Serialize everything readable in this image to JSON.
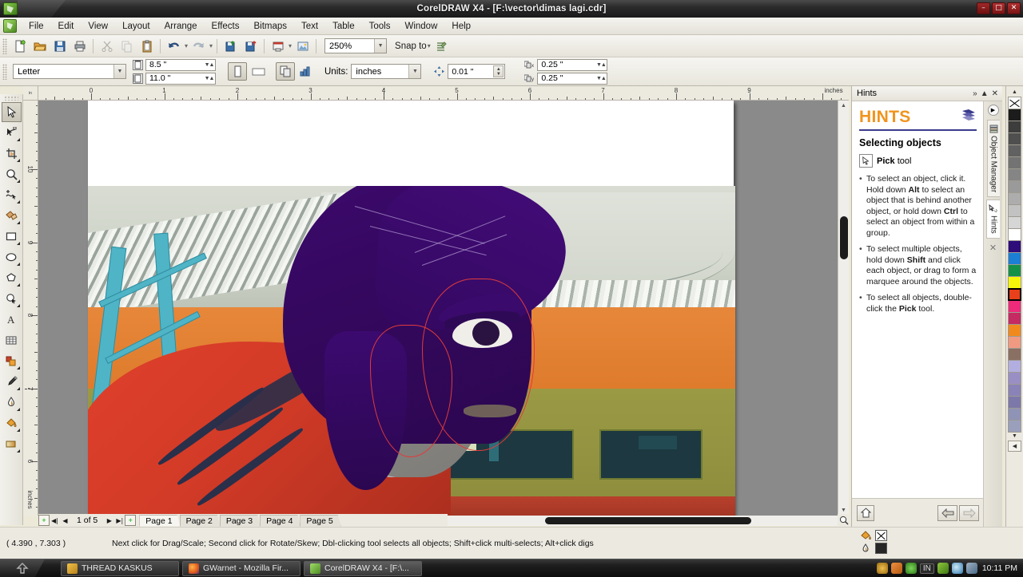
{
  "window": {
    "title": "CorelDRAW X4 - [F:\\vector\\dimas lagi.cdr]",
    "minimize_label": "–",
    "maximize_label": "□",
    "close_label": "✕"
  },
  "menubar": {
    "items": [
      {
        "label": "File",
        "icon": "file-menu"
      },
      {
        "label": "Edit",
        "icon": "edit-menu"
      },
      {
        "label": "View",
        "icon": "view-menu"
      },
      {
        "label": "Layout",
        "icon": "layout-menu"
      },
      {
        "label": "Arrange",
        "icon": "arrange-menu"
      },
      {
        "label": "Effects",
        "icon": "effects-menu"
      },
      {
        "label": "Bitmaps",
        "icon": "bitmaps-menu"
      },
      {
        "label": "Text",
        "icon": "text-menu"
      },
      {
        "label": "Table",
        "icon": "table-menu"
      },
      {
        "label": "Tools",
        "icon": "tools-menu"
      },
      {
        "label": "Window",
        "icon": "window-menu"
      },
      {
        "label": "Help",
        "icon": "help-menu"
      }
    ]
  },
  "standard_toolbar": {
    "buttons": [
      {
        "name": "new-document-button",
        "icon": "new-file-icon"
      },
      {
        "name": "open-document-button",
        "icon": "folder-open-icon"
      },
      {
        "name": "save-document-button",
        "icon": "floppy-disk-icon"
      },
      {
        "name": "print-button",
        "icon": "printer-icon"
      },
      {
        "name": "cut-button",
        "icon": "scissors-icon"
      },
      {
        "name": "copy-button",
        "icon": "copy-icon"
      },
      {
        "name": "paste-button",
        "icon": "clipboard-icon"
      },
      {
        "name": "undo-button",
        "icon": "undo-arrow-icon"
      },
      {
        "name": "redo-button",
        "icon": "redo-arrow-icon"
      },
      {
        "name": "import-button",
        "icon": "import-icon"
      },
      {
        "name": "export-button",
        "icon": "export-icon"
      },
      {
        "name": "publish-pdf-button",
        "icon": "pdf-icon"
      },
      {
        "name": "application-launcher-button",
        "icon": "app-launcher-icon"
      }
    ],
    "zoom_level": "250%",
    "snap_to_label": "Snap to",
    "snap_icon": "snap-icon"
  },
  "property_bar": {
    "paper_type": "Letter",
    "page_width": "8.5 \"",
    "page_height": "11.0 \"",
    "orientation_portrait_icon": "portrait-icon",
    "orientation_landscape_icon": "landscape-icon",
    "all_pages_icon": "all-pages-icon",
    "current_page_icon": "current-page-icon",
    "units_label": "Units:",
    "units_value": "inches",
    "nudge_icon": "nudge-icon",
    "nudge_offset": "0.01 \"",
    "duplicate_x_label": "x",
    "duplicate_x": "0.25 \"",
    "duplicate_y_label": "y",
    "duplicate_y": "0.25 \""
  },
  "toolbox": {
    "tools": [
      {
        "name": "pick-tool",
        "icon": "arrow-cursor-icon",
        "active": true,
        "flyout": false
      },
      {
        "name": "shape-tool",
        "icon": "node-edit-icon",
        "active": false,
        "flyout": true
      },
      {
        "name": "crop-tool",
        "icon": "crop-icon",
        "active": false,
        "flyout": true
      },
      {
        "name": "zoom-tool",
        "icon": "magnifier-icon",
        "active": false,
        "flyout": true
      },
      {
        "name": "freehand-tool",
        "icon": "freehand-curve-icon",
        "active": false,
        "flyout": true
      },
      {
        "name": "smart-fill-tool",
        "icon": "smart-fill-icon",
        "active": false,
        "flyout": true
      },
      {
        "name": "rectangle-tool",
        "icon": "rectangle-icon",
        "active": false,
        "flyout": true
      },
      {
        "name": "ellipse-tool",
        "icon": "ellipse-icon",
        "active": false,
        "flyout": true
      },
      {
        "name": "polygon-tool",
        "icon": "polygon-icon",
        "active": false,
        "flyout": true
      },
      {
        "name": "basic-shapes-tool",
        "icon": "basic-shapes-icon",
        "active": false,
        "flyout": true
      },
      {
        "name": "text-tool",
        "icon": "letter-a-icon",
        "active": false,
        "flyout": false
      },
      {
        "name": "table-tool",
        "icon": "grid-table-icon",
        "active": false,
        "flyout": false
      },
      {
        "name": "interactive-blend-tool",
        "icon": "blend-icon",
        "active": false,
        "flyout": true
      },
      {
        "name": "eyedropper-tool",
        "icon": "eyedropper-icon",
        "active": false,
        "flyout": true
      },
      {
        "name": "outline-tool",
        "icon": "pen-nib-icon",
        "active": false,
        "flyout": true
      },
      {
        "name": "fill-tool",
        "icon": "paint-bucket-icon",
        "active": false,
        "flyout": true
      },
      {
        "name": "interactive-fill-tool",
        "icon": "interactive-fill-icon",
        "active": false,
        "flyout": true
      }
    ]
  },
  "rulers": {
    "corner_label": "in",
    "unit_label": "inches",
    "horizontal_ticks": [
      "0",
      "1",
      "2",
      "3",
      "4",
      "5",
      "6",
      "7",
      "8",
      "9"
    ],
    "vertical_ticks": [
      "10",
      "9",
      "8",
      "7",
      "6"
    ]
  },
  "canvas": {
    "artwork_description": "vector tracing of a person with purple hair and red hoodie over photo of building"
  },
  "page_nav": {
    "first_icon": "first-page-icon",
    "prev_icon": "prev-page-icon",
    "next_icon": "next-page-icon",
    "last_icon": "last-page-icon",
    "add_page_icon": "add-page-icon",
    "page_counter": "1 of 5",
    "tabs": [
      {
        "label": "Page 1",
        "active": true
      },
      {
        "label": "Page 2",
        "active": false
      },
      {
        "label": "Page 3",
        "active": false
      },
      {
        "label": "Page 4",
        "active": false
      },
      {
        "label": "Page 5",
        "active": false
      }
    ]
  },
  "docker": {
    "title": "Hints",
    "expand_icon": "chevron-double-right-icon",
    "collapse_icon": "chevron-up-icon",
    "close_icon": "close-icon",
    "heading": "HINTS",
    "heading_icon": "book-icon",
    "section_title": "Selecting objects",
    "tool_icon": "pick-tool-icon",
    "tool_name": "Pick",
    "tool_suffix": " tool",
    "bullets": [
      "To select an object, click it. Hold down Alt to select an object that is behind another object, or hold down Ctrl to select an object from within a group.",
      "To select multiple objects, hold down Shift and click each object, or drag to form a marquee around the objects.",
      "To select all objects, double-click the Pick tool."
    ],
    "home_icon": "home-icon",
    "back_icon": "back-arrow-icon",
    "forward_icon": "forward-arrow-icon",
    "side_tabs": [
      {
        "label": "Object Manager",
        "icon": "object-manager-icon",
        "selected": false
      },
      {
        "label": "Hints",
        "icon": "hints-question-icon",
        "selected": true
      },
      {
        "label": "",
        "icon": "close-docker-icon",
        "selected": false
      }
    ]
  },
  "palette": {
    "scroll_up_icon": "palette-scroll-up-icon",
    "scroll_down_icon": "palette-scroll-down-icon",
    "expand_icon": "palette-expand-icon",
    "colors": [
      {
        "hex": "#ffffff",
        "name": "none",
        "selected": false
      },
      {
        "hex": "#1c1c1c",
        "name": "black",
        "selected": false
      },
      {
        "hex": "#3d3d3d",
        "name": "gray-90",
        "selected": false
      },
      {
        "hex": "#4f4f4f",
        "name": "gray-80",
        "selected": false
      },
      {
        "hex": "#616161",
        "name": "gray-70",
        "selected": false
      },
      {
        "hex": "#737373",
        "name": "gray-60",
        "selected": false
      },
      {
        "hex": "#858585",
        "name": "gray-50",
        "selected": false
      },
      {
        "hex": "#9a9a9a",
        "name": "gray-40",
        "selected": false
      },
      {
        "hex": "#adadad",
        "name": "gray-30",
        "selected": false
      },
      {
        "hex": "#c2c2c2",
        "name": "gray-20",
        "selected": false
      },
      {
        "hex": "#d6d6d6",
        "name": "gray-10",
        "selected": false
      },
      {
        "hex": "#ffffff",
        "name": "white",
        "selected": false
      },
      {
        "hex": "#2e0c7a",
        "name": "dark-violet",
        "selected": false
      },
      {
        "hex": "#1b7fd4",
        "name": "blue",
        "selected": false
      },
      {
        "hex": "#159147",
        "name": "green",
        "selected": false
      },
      {
        "hex": "#f6f60a",
        "name": "yellow",
        "selected": false
      },
      {
        "hex": "#e8401a",
        "name": "red",
        "selected": true
      },
      {
        "hex": "#ee2a7b",
        "name": "magenta",
        "selected": false
      },
      {
        "hex": "#c62a62",
        "name": "deep-pink",
        "selected": false
      },
      {
        "hex": "#f08a1e",
        "name": "orange",
        "selected": false
      },
      {
        "hex": "#f09a82",
        "name": "salmon",
        "selected": false
      },
      {
        "hex": "#8a6f63",
        "name": "brown",
        "selected": false
      },
      {
        "hex": "#b3aee0",
        "name": "light-lavender",
        "selected": false
      },
      {
        "hex": "#9a8fc4",
        "name": "lavender",
        "selected": false
      },
      {
        "hex": "#8a83b8",
        "name": "muted-violet",
        "selected": false
      },
      {
        "hex": "#7d78aa",
        "name": "dusty-purple",
        "selected": false
      },
      {
        "hex": "#8f93b5",
        "name": "blue-gray",
        "selected": false
      },
      {
        "hex": "#9aa0bc",
        "name": "pale-blue-gray",
        "selected": false
      }
    ]
  },
  "status_bar": {
    "coordinates": "( 4.390 , 7.303 )",
    "message": "Next click for Drag/Scale; Second click for Rotate/Skew; Dbl-clicking tool selects all objects; Shift+click multi-selects; Alt+click digs",
    "fill_icon": "paint-bucket-icon",
    "fill_value": "none",
    "outline_icon": "pen-nib-icon",
    "outline_color": "#262626"
  },
  "taskbar": {
    "start_icon": "start-button-icon",
    "items": [
      {
        "label": "THREAD KASKUS",
        "icon": "folder-icon",
        "color": "#d8a23a",
        "active": false
      },
      {
        "label": "GWarnet - Mozilla Fir...",
        "icon": "firefox-icon",
        "color": "#e06c1f",
        "active": false
      },
      {
        "label": "CorelDRAW X4 - [F:\\...",
        "icon": "coreldraw-icon",
        "color": "#79b33d",
        "active": true
      }
    ],
    "tray_icons": [
      {
        "name": "action-center-icon",
        "color": "#d8a23a"
      },
      {
        "name": "media-player-icon",
        "color": "#e07b2a"
      },
      {
        "name": "updater-icon",
        "color": "#5bb34a"
      },
      {
        "name": "nvidia-icon",
        "color": "#6fae2a"
      },
      {
        "name": "volume-icon",
        "color": "#3f8fc4"
      },
      {
        "name": "network-icon",
        "color": "#7a90a8"
      }
    ],
    "language": "IN",
    "clock": "10:11 PM"
  }
}
